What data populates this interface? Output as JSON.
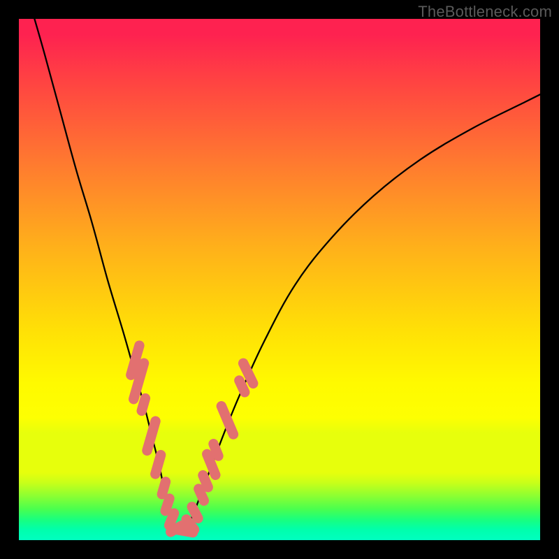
{
  "watermark": "TheBottleneck.com",
  "colors": {
    "frame_border": "#000000",
    "curve": "#000000",
    "marker_fill": "#e27070",
    "gradient_top": "#fe2250",
    "gradient_bottom": "#00ffc0"
  },
  "chart_data": {
    "type": "line",
    "title": "",
    "xlabel": "",
    "ylabel": "",
    "xlim": [
      0,
      100
    ],
    "ylim": [
      0,
      100
    ],
    "series": [
      {
        "name": "bottleneck-curve",
        "x": [
          3,
          5,
          8,
          11,
          14,
          17,
          20,
          22,
          24,
          25.5,
          27,
          28,
          29,
          30,
          31.5,
          33,
          35,
          38,
          42,
          47,
          53,
          60,
          68,
          77,
          87,
          97,
          100
        ],
        "y": [
          100,
          93,
          82,
          71,
          61,
          50,
          40,
          33,
          26,
          20,
          14,
          9,
          5,
          2,
          2,
          4,
          9,
          17,
          27,
          38,
          49,
          58,
          66,
          73,
          79,
          84,
          85.5
        ]
      }
    ],
    "markers": {
      "name": "highlighted-points",
      "shape": "capsule",
      "points": [
        {
          "x": 22.3,
          "y": 34.5,
          "len": 3.0,
          "angle": -74
        },
        {
          "x": 23.0,
          "y": 30.5,
          "len": 3.5,
          "angle": -74
        },
        {
          "x": 23.9,
          "y": 26.0,
          "len": 1.7,
          "angle": -74
        },
        {
          "x": 25.4,
          "y": 20.0,
          "len": 3.0,
          "angle": -74
        },
        {
          "x": 26.7,
          "y": 14.5,
          "len": 2.2,
          "angle": -74
        },
        {
          "x": 27.8,
          "y": 10.0,
          "len": 1.7,
          "angle": -74
        },
        {
          "x": 28.5,
          "y": 6.8,
          "len": 1.7,
          "angle": -72
        },
        {
          "x": 29.3,
          "y": 4.0,
          "len": 1.7,
          "angle": -68
        },
        {
          "x": 30.2,
          "y": 2.2,
          "len": 1.7,
          "angle": -30
        },
        {
          "x": 31.5,
          "y": 1.8,
          "len": 2.2,
          "angle": 10
        },
        {
          "x": 32.9,
          "y": 3.0,
          "len": 1.7,
          "angle": 52
        },
        {
          "x": 33.8,
          "y": 5.3,
          "len": 1.7,
          "angle": 62
        },
        {
          "x": 35.0,
          "y": 8.7,
          "len": 1.7,
          "angle": 66
        },
        {
          "x": 35.8,
          "y": 11.3,
          "len": 1.7,
          "angle": 67
        },
        {
          "x": 36.9,
          "y": 14.5,
          "len": 2.4,
          "angle": 68
        },
        {
          "x": 37.8,
          "y": 17.3,
          "len": 1.7,
          "angle": 68
        },
        {
          "x": 40.0,
          "y": 23.0,
          "len": 3.0,
          "angle": 67
        },
        {
          "x": 42.8,
          "y": 29.5,
          "len": 1.7,
          "angle": 65
        },
        {
          "x": 44.0,
          "y": 32.0,
          "len": 2.4,
          "angle": 64
        }
      ]
    }
  }
}
